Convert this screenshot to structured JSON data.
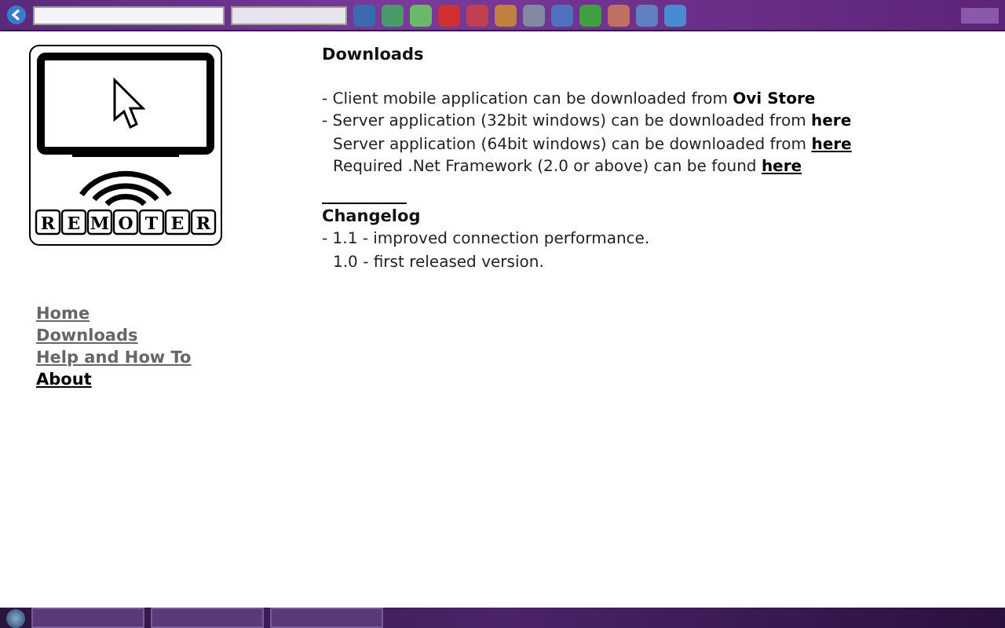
{
  "logo": {
    "letters": [
      "R",
      "E",
      "M",
      "O",
      "T",
      "E",
      "R"
    ]
  },
  "nav": [
    {
      "label": "Home",
      "selected": false
    },
    {
      "label": "Downloads",
      "selected": false
    },
    {
      "label": "Help and How To",
      "selected": false
    },
    {
      "label": "About",
      "selected": true
    }
  ],
  "downloads": {
    "title": "Downloads",
    "lines": [
      {
        "text": "- Client mobile application can be downloaded from ",
        "tail": "Ovi Store",
        "kind": "bold"
      },
      {
        "text": "- Server application (32bit windows) can be downloaded from ",
        "tail": "here",
        "kind": "bold"
      },
      {
        "text": "Server application (64bit windows) can be downloaded from ",
        "tail": "here",
        "kind": "link"
      },
      {
        "text": "Required .Net Framework (2.0 or above) can be found ",
        "tail": "here",
        "kind": "link"
      }
    ]
  },
  "changelog": {
    "title": "Changelog",
    "lines": [
      "- 1.1 - improved connection performance.",
      "1.0 - first released version."
    ]
  }
}
